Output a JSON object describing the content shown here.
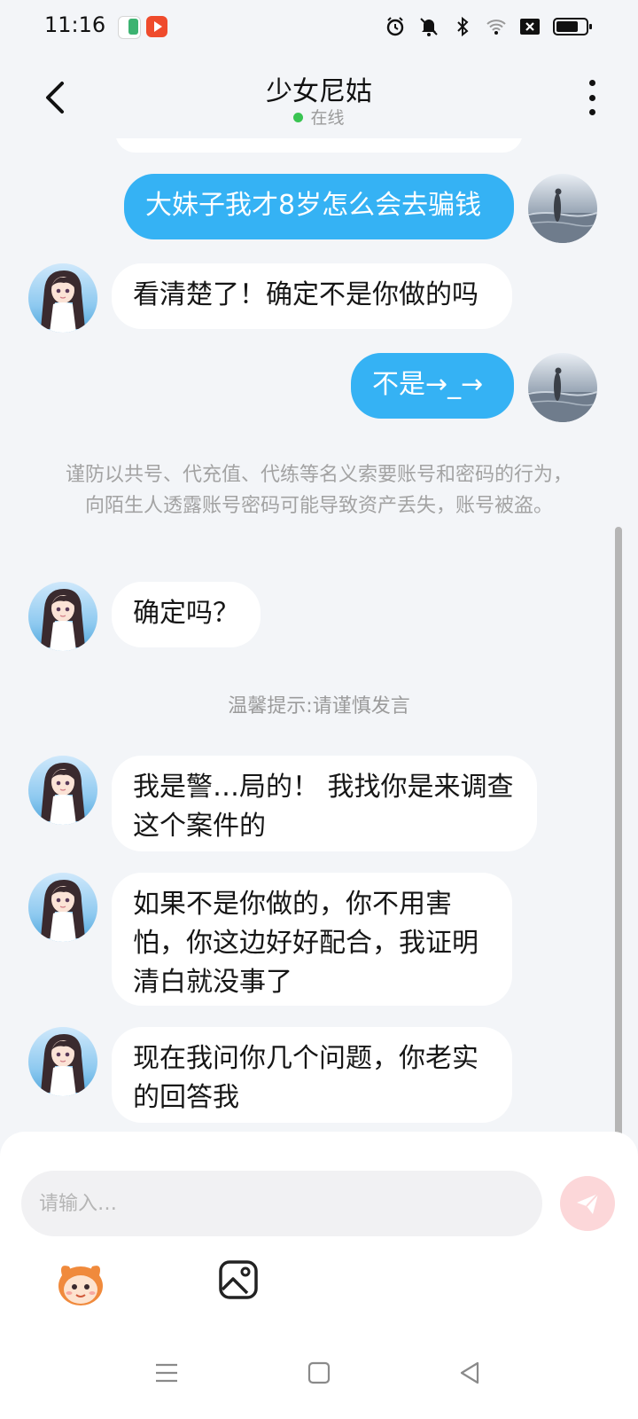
{
  "status_bar": {
    "time": "11:16",
    "icons": [
      "novel-app-icon",
      "video-app-icon",
      "alarm-icon",
      "mute-icon",
      "bluetooth-icon",
      "wifi-icon",
      "sim-off-icon",
      "battery-icon"
    ]
  },
  "header": {
    "title": "少女尼姑",
    "status": "在线",
    "status_color": "#39c452"
  },
  "messages": [
    {
      "side": "out",
      "text": "大妹子我才8岁怎么会去骗钱"
    },
    {
      "side": "in",
      "text": "看清楚了！确定不是你做的吗"
    },
    {
      "side": "out",
      "text": "不是→_→"
    },
    {
      "side": "in",
      "text": "确定吗？"
    },
    {
      "side": "in",
      "text": "我是警…局的！ 我找你是来调查这个案件的"
    },
    {
      "side": "in",
      "text": "如果不是你做的，你不用害怕，你这边好好配合，我证明清白就没事了"
    },
    {
      "side": "in",
      "text": "现在我问你几个问题，你老实的回答我"
    }
  ],
  "system_notice": "谨防以共号、代充值、代练等名义索要账号和密码的行为，向陌生人透露账号密码可能导致资产丢失，账号被盗。",
  "warm_tip": "温馨提示:请谨慎发言",
  "input": {
    "placeholder": "请输入…",
    "value": ""
  },
  "toolbar": [
    "emoji-mascot-icon",
    "image-icon"
  ],
  "colors": {
    "outgoing_bubble": "#35b2f4",
    "incoming_bubble": "#ffffff",
    "send_button": "#fcd7d9",
    "background": "#f3f5f8"
  }
}
